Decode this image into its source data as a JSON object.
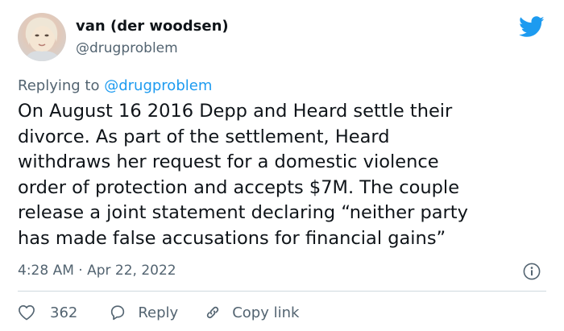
{
  "author": {
    "display_name": "van (der woodsen)",
    "handle": "@drugproblem",
    "avatar_icon": "profile-photo"
  },
  "reply_context": {
    "prefix": "Replying to",
    "mention": "@drugproblem"
  },
  "tweet": {
    "lines": [
      "On August 16 2016 Depp and Heard settle their",
      "divorce. As part of the settlement, Heard",
      "withdraws her request for a domestic violence",
      "order of protection and accepts $7M. The couple",
      "release a joint statement declaring “neither party",
      "has made false accusations for financial gains”"
    ]
  },
  "meta": {
    "time": "4:28 AM",
    "separator": "·",
    "date": "Apr 22, 2022"
  },
  "actions": {
    "like_count": "362",
    "reply_label": "Reply",
    "copy_label": "Copy link"
  },
  "icons": {
    "brand": "twitter-bird-icon",
    "info": "info-icon",
    "like": "heart-icon",
    "reply": "speech-bubble-icon",
    "copy": "link-icon"
  },
  "colors": {
    "brand_blue": "#1d9bf0",
    "text": "#0f1419",
    "secondary": "#536471",
    "divider": "#cfd9de"
  }
}
